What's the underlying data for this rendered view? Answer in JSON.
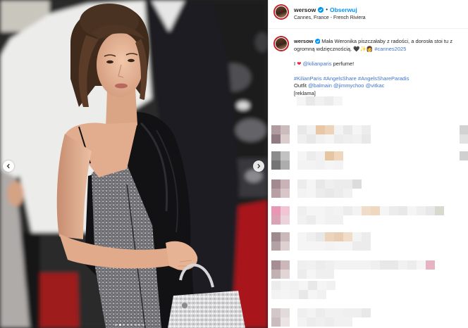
{
  "photo": {
    "prev_icon": "chevron-left-icon",
    "next_icon": "chevron-right-icon",
    "carousel_dots": 8,
    "active_dot": 1
  },
  "header": {
    "username": "wersow",
    "verified_icon": "verified-badge-icon",
    "separator": "•",
    "follow_label": "Obserwuj",
    "location": "Cannes, France - French Riviera"
  },
  "caption": {
    "username": "wersow",
    "text": "Mała Weronika piszczałaby z radości, a dorosła stoi tu z ogromną wdzięcznością. 🖤✨👩",
    "hashtag": "#cannes2025",
    "perfume_prefix": "I",
    "heart": "❤",
    "perfume_mention": "@kilianparis",
    "perfume_suffix": "perfume!",
    "hashtags": [
      "#KilianParis",
      "#AngelsShare",
      "#AngelsShareParadis"
    ],
    "outfit_label": "Outfit",
    "outfit_mentions": [
      "@balmain",
      "@jimmychoo",
      "@vitkac"
    ],
    "ad_label": "[reklama]"
  },
  "theme": {
    "accent": "#0095f6",
    "link": "#3f74c9",
    "text": "#262626",
    "avatar_ring": "#d62a2a"
  }
}
